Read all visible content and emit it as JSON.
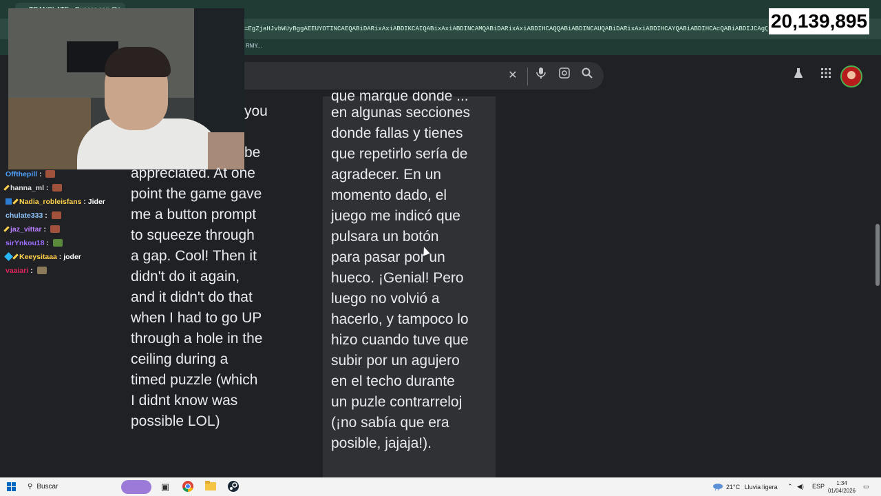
{
  "browser": {
    "tab_title": "TRANSLATE - Buscar con Go",
    "url": "=EgZjaHJvbWUyBggAEEUYOTINCAEQABiDARixAxiABDIKCAIQABixAxiABDINCAMQABiDARixAxiABDIHCAQQABiABDINCAUQABiDARixAxiABDIHCAYQABiABDIHCAcQABiABDIJCAgQRRg7GG",
    "bookmark": "RMY..."
  },
  "overlay": {
    "viewer_count": "20,139,895"
  },
  "search": {
    "clear_icon": "close-icon",
    "mic_icon": "microphone-icon",
    "lens_icon": "camera-search-icon",
    "search_icon": "search-icon"
  },
  "header_icons": [
    "flask-icon",
    "apps-grid-icon",
    "account-avatar"
  ],
  "chat": [
    {
      "user": "Offthepill",
      "color": "#4fa3ff",
      "message": "",
      "emote": true
    },
    {
      "user": "hanna_ml",
      "color": "#e0e0e0",
      "message": "",
      "emote": true
    },
    {
      "user": "Nadia_robleisfans",
      "color": "#ffd24d",
      "message": "Jider",
      "emote": false
    },
    {
      "user": "chulate333",
      "color": "#8ec5ff",
      "message": "",
      "emote": true
    },
    {
      "user": "jaz_vittar",
      "color": "#b87dff",
      "message": "",
      "emote": true
    },
    {
      "user": "sirYnkou18",
      "color": "#9b6dff",
      "message": "",
      "emote": true
    },
    {
      "user": "Keeysitaaa",
      "color": "#ffd24d",
      "message": "joder",
      "emote": false
    },
    {
      "user": "vaaiari",
      "color": "#e0245e",
      "message": "",
      "emote": true
    }
  ],
  "translation": {
    "source_lines": [
      "you",
      "",
      "be",
      "appreciated. At one",
      "point the game gave",
      "me a button prompt",
      "to squeeze through",
      "a gap. Cool! Then it",
      "didn't do it again,",
      "and it didn't do that",
      "when I had to go UP",
      "through a hole in the",
      "ceiling during a",
      "timed puzzle (which",
      "I didnt know was",
      "possible LOL)"
    ],
    "target_lines": [
      "que marque dónde ...",
      "en algunas secciones",
      "donde fallas y tienes",
      "que repetirlo sería de",
      "agradecer. En un",
      "momento dado, el",
      "juego me indicó que",
      "pulsara un botón",
      "para pasar por un",
      "hueco. ¡Genial! Pero",
      "luego no volvió a",
      "hacerlo, y tampoco lo",
      "hizo cuando tuve que",
      "subir por un agujero",
      "en el techo durante",
      "un puzle contrarreloj",
      "(¡no sabía que era",
      "posible, jajaja!)."
    ]
  },
  "taskbar": {
    "search_label": "Buscar",
    "weather_temp": "21°C",
    "weather_text": "Lluvia ligera",
    "language": "ESP",
    "time": "1:34",
    "date": "01/04/2026"
  },
  "colors": {
    "page_bg": "#202124",
    "browser_chrome": "#1f3b33",
    "panel_bg": "#303134",
    "text": "#e8eaed"
  }
}
